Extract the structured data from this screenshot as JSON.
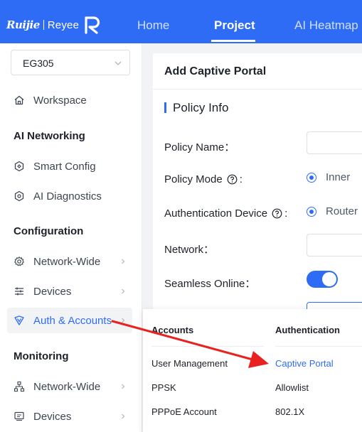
{
  "brand": {
    "primary": "Ruijie",
    "secondary": "Reyee"
  },
  "nav": {
    "tabs": [
      {
        "label": "Home"
      },
      {
        "label": "Project"
      },
      {
        "label": "AI Heatmap"
      }
    ],
    "active": "Project",
    "accent": "#2f6cf6"
  },
  "sidebar": {
    "site": "EG305",
    "workspace": "Workspace",
    "sections": {
      "ai_networking": "AI Networking",
      "configuration": "Configuration",
      "monitoring": "Monitoring"
    },
    "items": {
      "smart_config": "Smart Config",
      "ai_diagnostics": "AI Diagnostics",
      "network_wide": "Network-Wide",
      "devices": "Devices",
      "auth_accounts": "Auth & Accounts",
      "mon_network_wide": "Network-Wide",
      "mon_devices": "Devices"
    }
  },
  "panel": {
    "title": "Add Captive Portal",
    "section": "Policy Info",
    "fields": {
      "policy_name": "Policy Name：",
      "policy_mode": "Policy Mode",
      "policy_mode_option": "Inner",
      "auth_device": "Authentication Device",
      "auth_device_option": "Router",
      "network": "Network：",
      "seamless": "Seamless Online："
    },
    "help_suffix": ":",
    "seamless_enabled": true
  },
  "submenu": {
    "accounts_header": "Accounts",
    "authentication_header": "Authentication",
    "accounts": [
      "User Management",
      "PPSK",
      "PPPoE Account"
    ],
    "authentication": [
      "Captive Portal",
      "Allowlist",
      "802.1X"
    ]
  },
  "annotation_color": "#e8231f"
}
